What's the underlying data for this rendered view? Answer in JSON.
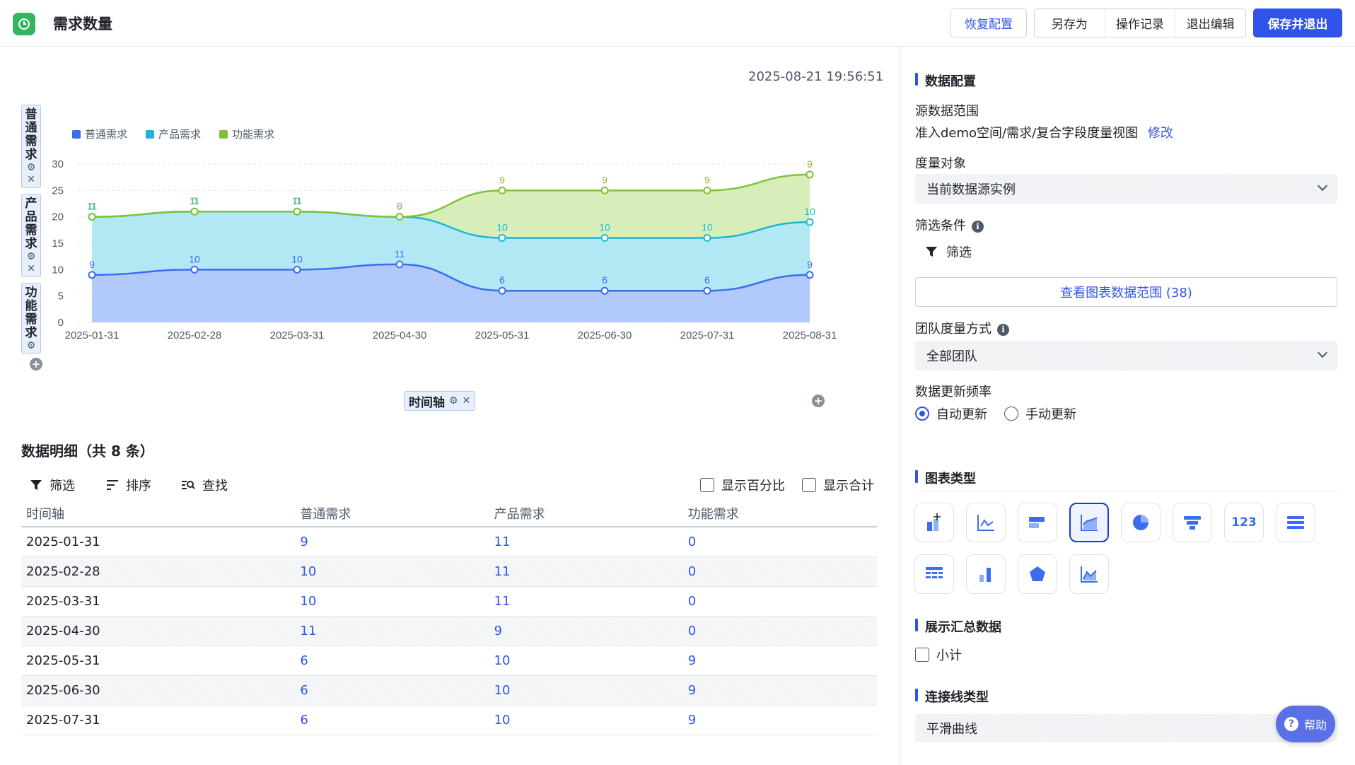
{
  "header": {
    "title": "需求数量",
    "restore_label": "恢复配置",
    "save_as_label": "另存为",
    "history_label": "操作记录",
    "exit_edit_label": "退出编辑",
    "save_exit_label": "保存并退出"
  },
  "chart_panel": {
    "timestamp": "2025-08-21 19:56:51",
    "y_tags": [
      {
        "label": "普通需求"
      },
      {
        "label": "产品需求"
      },
      {
        "label": "功能需求"
      }
    ],
    "x_tag": "时间轴"
  },
  "chart_data": {
    "type": "area",
    "stacked": true,
    "smooth": true,
    "categories": [
      "2025-01-31",
      "2025-02-28",
      "2025-03-31",
      "2025-04-30",
      "2025-05-31",
      "2025-06-30",
      "2025-07-31",
      "2025-08-31"
    ],
    "series": [
      {
        "name": "普通需求",
        "values": [
          9,
          10,
          10,
          11,
          6,
          6,
          6,
          9
        ],
        "color": "#3c6cf0"
      },
      {
        "name": "产品需求",
        "values": [
          11,
          11,
          11,
          9,
          10,
          10,
          10,
          10
        ],
        "color": "#1fb6d6"
      },
      {
        "name": "功能需求",
        "values": [
          0,
          0,
          0,
          0,
          9,
          9,
          9,
          9
        ],
        "color": "#7ec23a"
      }
    ],
    "yticks": [
      0,
      5,
      10,
      15,
      20,
      25,
      30
    ],
    "ylim": [
      0,
      30
    ],
    "legend_position": "top-left"
  },
  "detail": {
    "title": "数据明细（共 8 条）",
    "filter_label": "筛选",
    "sort_label": "排序",
    "find_label": "查找",
    "show_percent_label": "显示百分比",
    "show_total_label": "显示合计",
    "columns": [
      "时间轴",
      "普通需求",
      "产品需求",
      "功能需求"
    ],
    "rows": [
      [
        "2025-01-31",
        "9",
        "11",
        "0"
      ],
      [
        "2025-02-28",
        "10",
        "11",
        "0"
      ],
      [
        "2025-03-31",
        "10",
        "11",
        "0"
      ],
      [
        "2025-04-30",
        "11",
        "9",
        "0"
      ],
      [
        "2025-05-31",
        "6",
        "10",
        "9"
      ],
      [
        "2025-06-30",
        "6",
        "10",
        "9"
      ],
      [
        "2025-07-31",
        "6",
        "10",
        "9"
      ]
    ]
  },
  "config": {
    "data_config_title": "数据配置",
    "source_range_label": "源数据范围",
    "source_range_value": "准入demo空间/需求/复合字段度量视图",
    "modify_label": "修改",
    "measure_target_label": "度量对象",
    "measure_target_value": "当前数据源实例",
    "filter_cond_label": "筛选条件",
    "filter_label": "筛选",
    "view_range_label": "查看图表数据范围 (38)",
    "team_measure_label": "团队度量方式",
    "team_measure_value": "全部团队",
    "update_freq_label": "数据更新频率",
    "auto_update_label": "自动更新",
    "manual_update_label": "手动更新",
    "chart_type_title": "图表类型",
    "chart_types": [
      "stacked-bar",
      "line",
      "horizontal-bar",
      "area",
      "pie",
      "funnel",
      "number",
      "list",
      "table",
      "column",
      "radar",
      "mixed"
    ],
    "summary_title": "展示汇总数据",
    "subtotal_label": "小计",
    "line_type_title": "连接线类型",
    "line_type_value": "平滑曲线"
  },
  "help_label": "帮助"
}
